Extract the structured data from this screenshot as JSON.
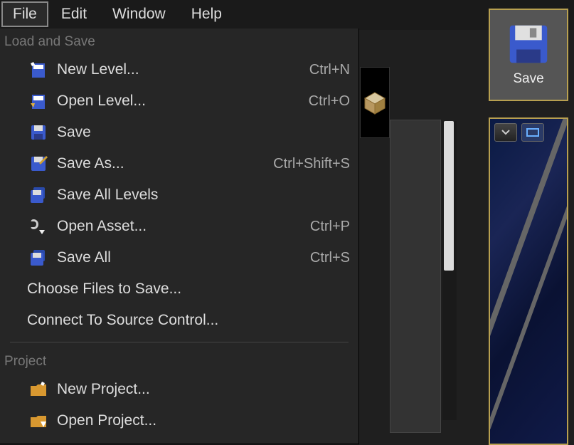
{
  "menubar": {
    "file": "File",
    "edit": "Edit",
    "window": "Window",
    "help": "Help"
  },
  "dropdown": {
    "section_load_save": "Load and Save",
    "new_level": {
      "label": "New Level...",
      "shortcut": "Ctrl+N"
    },
    "open_level": {
      "label": "Open Level...",
      "shortcut": "Ctrl+O"
    },
    "save": {
      "label": "Save",
      "shortcut": ""
    },
    "save_as": {
      "label": "Save As...",
      "shortcut": "Ctrl+Shift+S"
    },
    "save_all_levels": {
      "label": "Save All Levels",
      "shortcut": ""
    },
    "open_asset": {
      "label": "Open Asset...",
      "shortcut": "Ctrl+P"
    },
    "save_all": {
      "label": "Save All",
      "shortcut": "Ctrl+S"
    },
    "choose_files": {
      "label": "Choose Files to Save...",
      "shortcut": ""
    },
    "source_control": {
      "label": "Connect To Source Control...",
      "shortcut": ""
    },
    "section_project": "Project",
    "new_project": {
      "label": "New Project...",
      "shortcut": ""
    },
    "open_project": {
      "label": "Open Project...",
      "shortcut": ""
    }
  },
  "toolbar": {
    "save_label": "Save"
  }
}
